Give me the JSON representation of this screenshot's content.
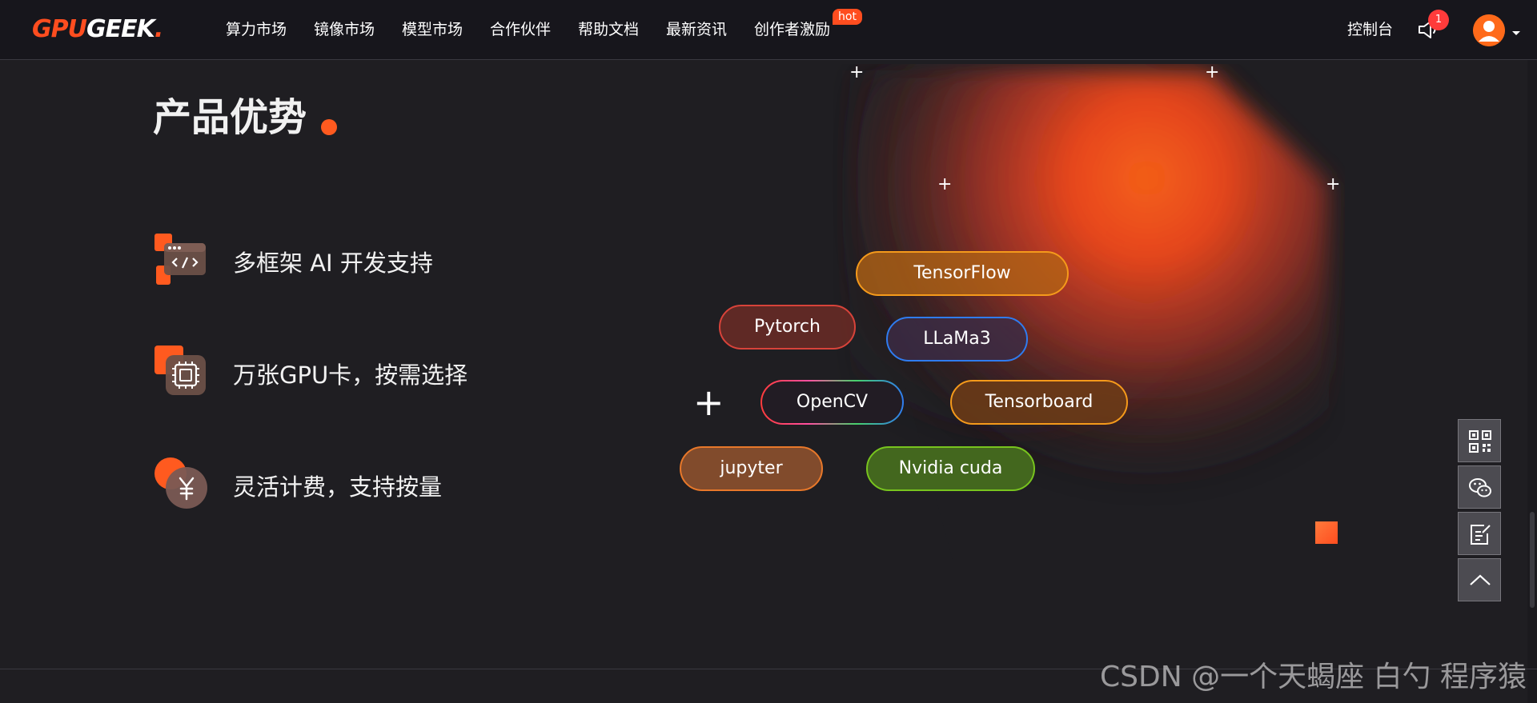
{
  "navbar": {
    "logo": {
      "part1": "GPU",
      "part2": "GEEK",
      "part3": "."
    },
    "items": [
      {
        "label": "算力市场"
      },
      {
        "label": "镜像市场"
      },
      {
        "label": "模型市场"
      },
      {
        "label": "合作伙伴"
      },
      {
        "label": "帮助文档"
      },
      {
        "label": "最新资讯"
      },
      {
        "label": "创作者激励"
      }
    ],
    "hot_badge": "hot",
    "console_label": "控制台",
    "notification_count": "1",
    "icons": [
      "megaphone-icon",
      "avatar",
      "chevron-down-icon"
    ]
  },
  "section": {
    "title": "产品优势",
    "features": [
      {
        "label": "多框架 AI 开发支持",
        "icon": "code-window-icon"
      },
      {
        "label": "万张GPU卡，按需选择",
        "icon": "chip-icon"
      },
      {
        "label": "灵活计费，支持按量",
        "icon": "yen-coin-icon"
      }
    ]
  },
  "frameworks": {
    "tensorflow": "TensorFlow",
    "pytorch": "Pytorch",
    "llama": "LLaMa3",
    "opencv": "OpenCV",
    "tensorboard": "Tensorboard",
    "jupyter": "jupyter",
    "cuda": "Nvidia cuda"
  },
  "floating_toolbar": [
    "qr-code-icon",
    "wechat-icon",
    "feedback-icon",
    "back-to-top-icon"
  ],
  "watermark": "CSDN @一个天蝎座 白勺 程序猿",
  "colors": {
    "accent": "#ff4d1f",
    "background": "#1f1e22",
    "navbar": "#17161c"
  }
}
